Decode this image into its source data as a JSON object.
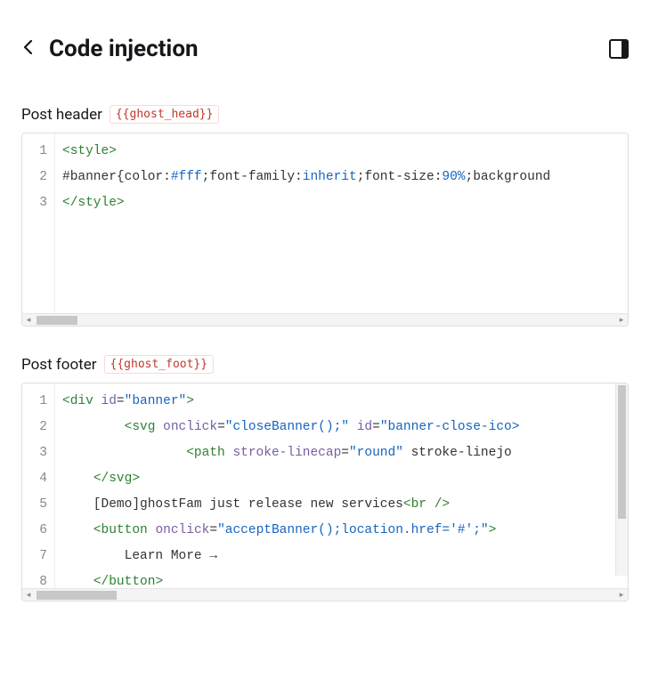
{
  "header": {
    "title": "Code injection"
  },
  "sections": {
    "head": {
      "label": "Post header",
      "tag": "{{ghost_head}}",
      "gutter": [
        "1",
        "2",
        "3"
      ],
      "code_plain": "<style>\n#banner{color:#fff;font-family:inherit;font-size:90%;background\n</style>"
    },
    "foot": {
      "label": "Post footer",
      "tag": "{{ghost_foot}}",
      "gutter": [
        "1",
        "2",
        "3",
        "4",
        "5",
        "6",
        "7",
        "8"
      ],
      "code_plain": "<div id=\"banner\">\n        <svg onclick=\"closeBanner();\" id=\"banner-close-ico\n                <path stroke-linecap=\"round\" stroke-linejo\n    </svg>\n    [Demo]ghostFam just release new services<br />\n    <button onclick=\"acceptBanner();location.href='#';\">\n        Learn More →\n    </button>"
    }
  }
}
